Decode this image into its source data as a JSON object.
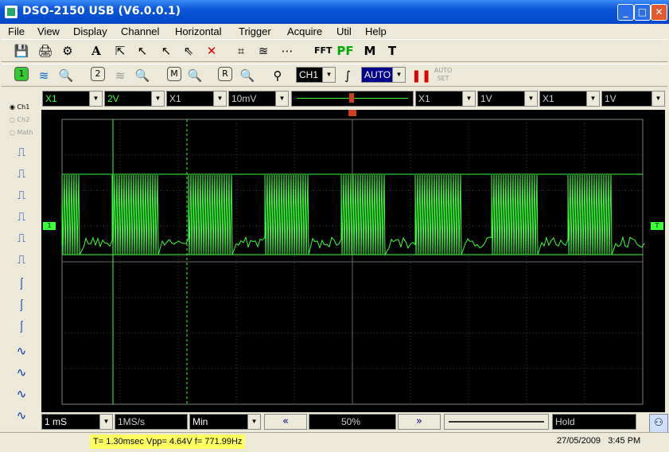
{
  "window": {
    "title": "DSO-2150 USB (V6.0.0.1)"
  },
  "menu": [
    "File",
    "View",
    "Display",
    "Channel",
    "Horizontal",
    "Trigger",
    "Acquire",
    "Util",
    "Help"
  ],
  "toolbar1": {
    "fft_label": "FFT",
    "pf_label": "PF",
    "m_label": "M",
    "t_label": "T"
  },
  "toolbar2": {
    "ch1_btn": "1",
    "ch2_btn": "2",
    "math_btn": "M",
    "ref_btn": "R",
    "trigger_source": "CH1",
    "trigger_mode": "AUTO",
    "auto_set_label": "AUTO SET"
  },
  "channel_bar": {
    "ch1_probe": "X1",
    "ch1_volts": "2V",
    "ch1_mult": "X1",
    "ch1_trig_level": "10mV",
    "ch2_probe": "X1",
    "ch2_volts": "1V",
    "ch2_mult": "X1",
    "ch2_volts2": "1V"
  },
  "left_panel": {
    "radio_ch1": "Ch1",
    "radio_ch2": "Ch2",
    "radio_math": "Math"
  },
  "scope": {
    "ch1_marker": "1",
    "trig_marker": "T"
  },
  "bottom_bar": {
    "timebase": "1 mS",
    "sample_rate": "1MS/s",
    "acquire_mode": "Min",
    "position": "50%",
    "run_state": "Hold"
  },
  "status": {
    "measurements": "T= 1.30msec  Vpp= 4.64V  f= 771.99Hz",
    "date": "27/05/2009",
    "time": "3:45 PM"
  },
  "colors": {
    "trace": "#38ff38",
    "grid": "#3c3c3c",
    "bg": "#000000"
  }
}
